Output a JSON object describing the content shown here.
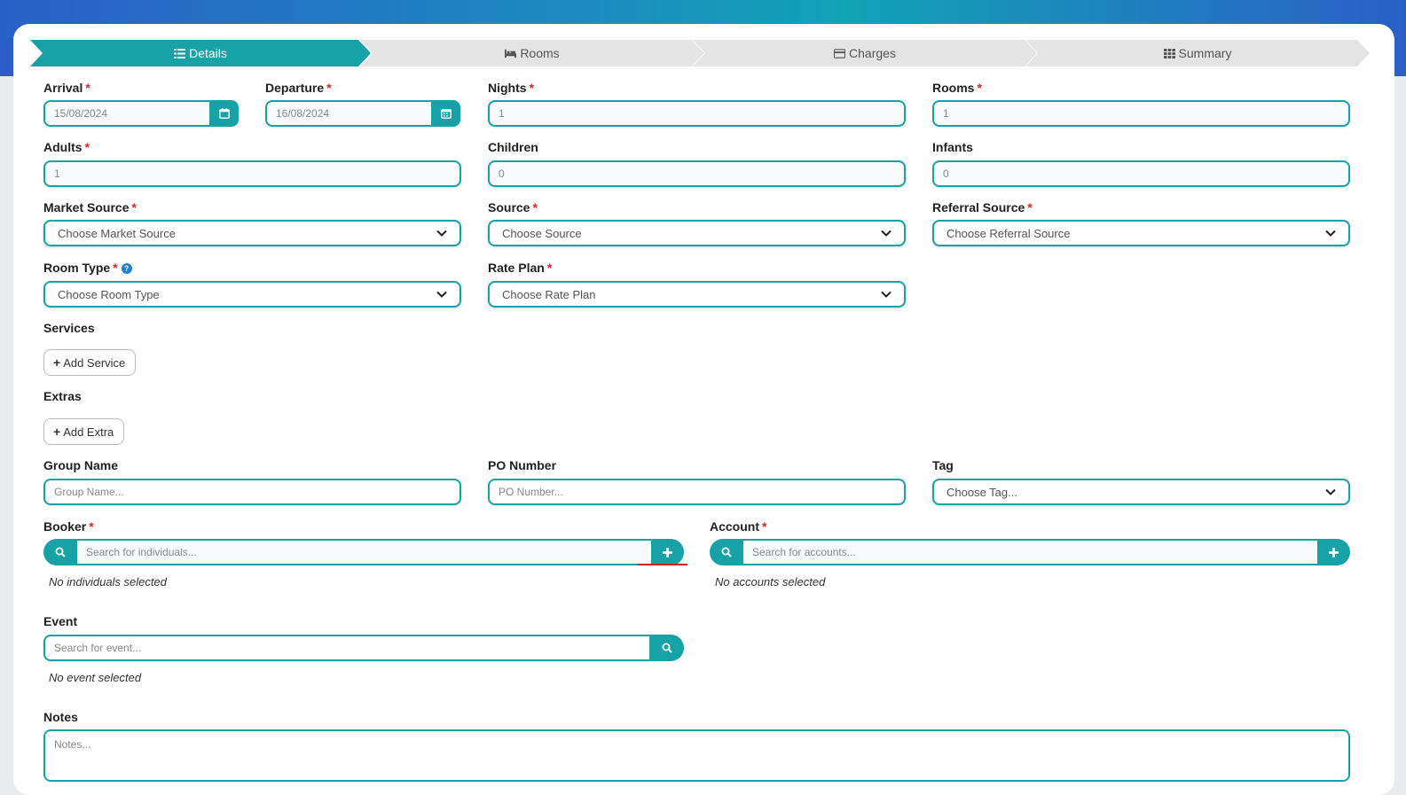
{
  "steps": [
    {
      "label": "Details",
      "icon": "list-icon",
      "active": true
    },
    {
      "label": "Rooms",
      "icon": "bed-icon",
      "active": false
    },
    {
      "label": "Charges",
      "icon": "credit-card-icon",
      "active": false
    },
    {
      "label": "Summary",
      "icon": "grid-icon",
      "active": false
    }
  ],
  "fields": {
    "arrival": {
      "label": "Arrival",
      "value": "15/08/2024"
    },
    "departure": {
      "label": "Departure",
      "value": "16/08/2024"
    },
    "nights": {
      "label": "Nights",
      "value": "1"
    },
    "rooms": {
      "label": "Rooms",
      "value": "1"
    },
    "adults": {
      "label": "Adults",
      "value": "1"
    },
    "children": {
      "label": "Children",
      "value": "0"
    },
    "infants": {
      "label": "Infants",
      "value": "0"
    },
    "market_source": {
      "label": "Market Source",
      "value": "Choose Market Source"
    },
    "source": {
      "label": "Source",
      "value": "Choose Source"
    },
    "referral_source": {
      "label": "Referral Source",
      "value": "Choose Referral Source"
    },
    "room_type": {
      "label": "Room Type",
      "value": "Choose Room Type"
    },
    "rate_plan": {
      "label": "Rate Plan",
      "value": "Choose Rate Plan"
    },
    "group_name": {
      "label": "Group Name",
      "placeholder": "Group Name..."
    },
    "po_number": {
      "label": "PO Number",
      "placeholder": "PO Number..."
    },
    "tag": {
      "label": "Tag",
      "value": "Choose Tag..."
    },
    "booker": {
      "label": "Booker",
      "placeholder": "Search for individuals...",
      "empty": "No individuals selected"
    },
    "account": {
      "label": "Account",
      "placeholder": "Search for accounts...",
      "empty": "No accounts selected"
    },
    "event": {
      "label": "Event",
      "placeholder": "Search for event...",
      "empty": "No event selected"
    },
    "notes": {
      "label": "Notes",
      "placeholder": "Notes..."
    }
  },
  "services": {
    "label": "Services",
    "button": "Add Service"
  },
  "extras": {
    "label": "Extras",
    "button": "Add Extra"
  },
  "required_mark": "*",
  "colors": {
    "accent": "#17a2a8",
    "required": "#e02424",
    "help": "#1e7fd8"
  }
}
